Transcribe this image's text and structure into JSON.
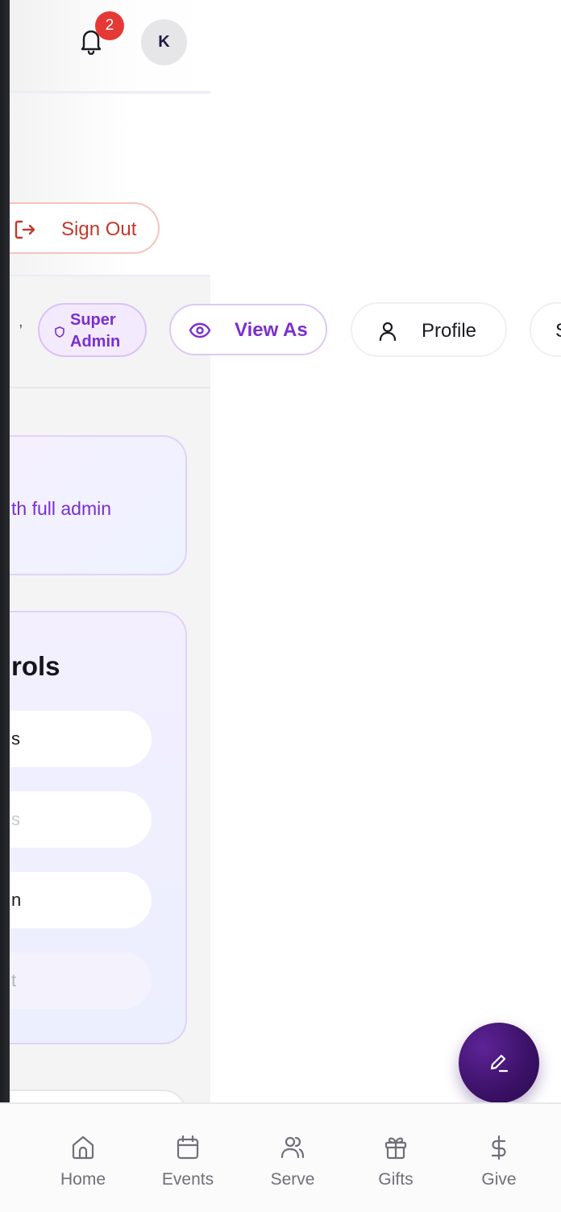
{
  "header": {
    "notification_count": "2",
    "avatar_initial": "K"
  },
  "drawer": {
    "sign_out_label": "Sign Out",
    "info_text": "th full admin",
    "controls_title": "rols",
    "control_items": [
      "s",
      "s",
      "n",
      "t"
    ]
  },
  "chips": {
    "separator": ",",
    "role_line1": "Super",
    "role_line2": "Admin",
    "view_as_label": "View As",
    "profile_label": "Profile",
    "next_label": "S"
  },
  "bottom_nav": {
    "items": [
      {
        "label": "Home",
        "icon": "home-icon"
      },
      {
        "label": "Events",
        "icon": "calendar-icon"
      },
      {
        "label": "Serve",
        "icon": "users-icon"
      },
      {
        "label": "Gifts",
        "icon": "gift-icon"
      },
      {
        "label": "Give",
        "icon": "dollar-icon"
      }
    ]
  },
  "fab": {
    "icon": "pen-icon"
  },
  "colors": {
    "accent_purple": "#7a2fd0",
    "danger_red": "#c0392b",
    "badge_red": "#e53935",
    "fab_purple": "#3a1166"
  }
}
